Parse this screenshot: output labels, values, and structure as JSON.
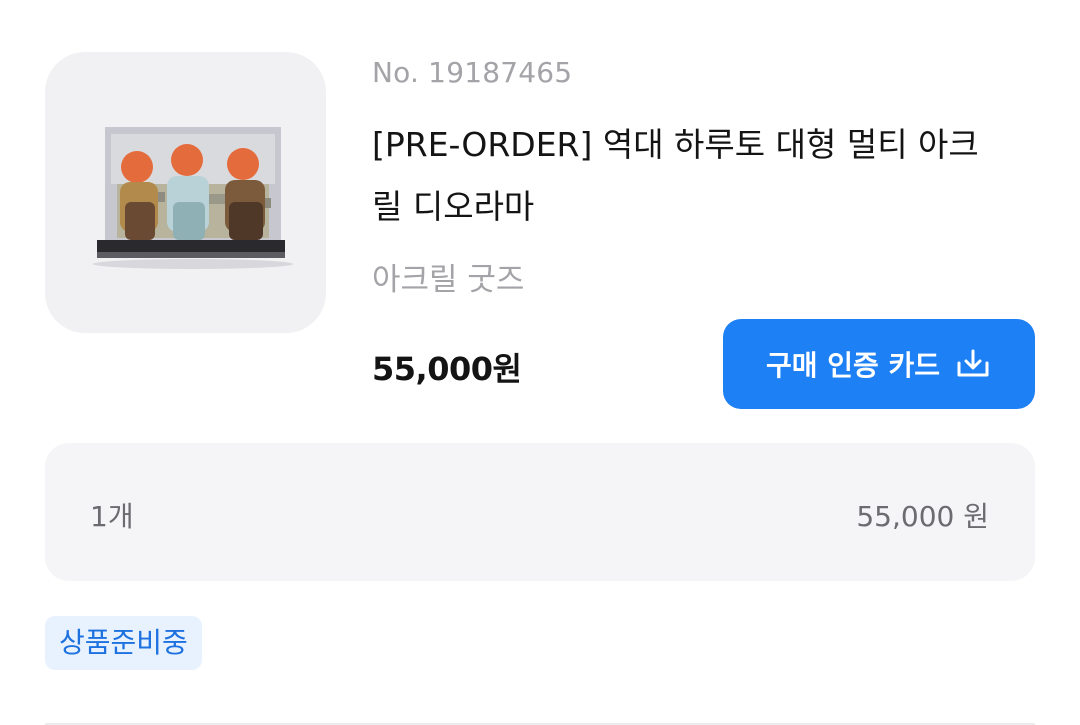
{
  "product": {
    "order_number": "No. 19187465",
    "title": "[PRE-ORDER] 역대 하루토 대형 멀티 아크릴 디오라마",
    "category": "아크릴 굿즈",
    "price": "55,000원",
    "image_icon": "product-image"
  },
  "actions": {
    "certificate_button_label": "구매 인증 카드",
    "certificate_icon": "download-icon"
  },
  "quantity_summary": {
    "quantity": "1개",
    "amount": "55,000 원"
  },
  "status": {
    "label": "상품준비중"
  },
  "colors": {
    "accent": "#1d80f5",
    "badge_bg": "#e8f2ff",
    "badge_text": "#1d72e0",
    "muted_text": "#a3a3a8",
    "panel_bg": "#f5f5f7"
  }
}
